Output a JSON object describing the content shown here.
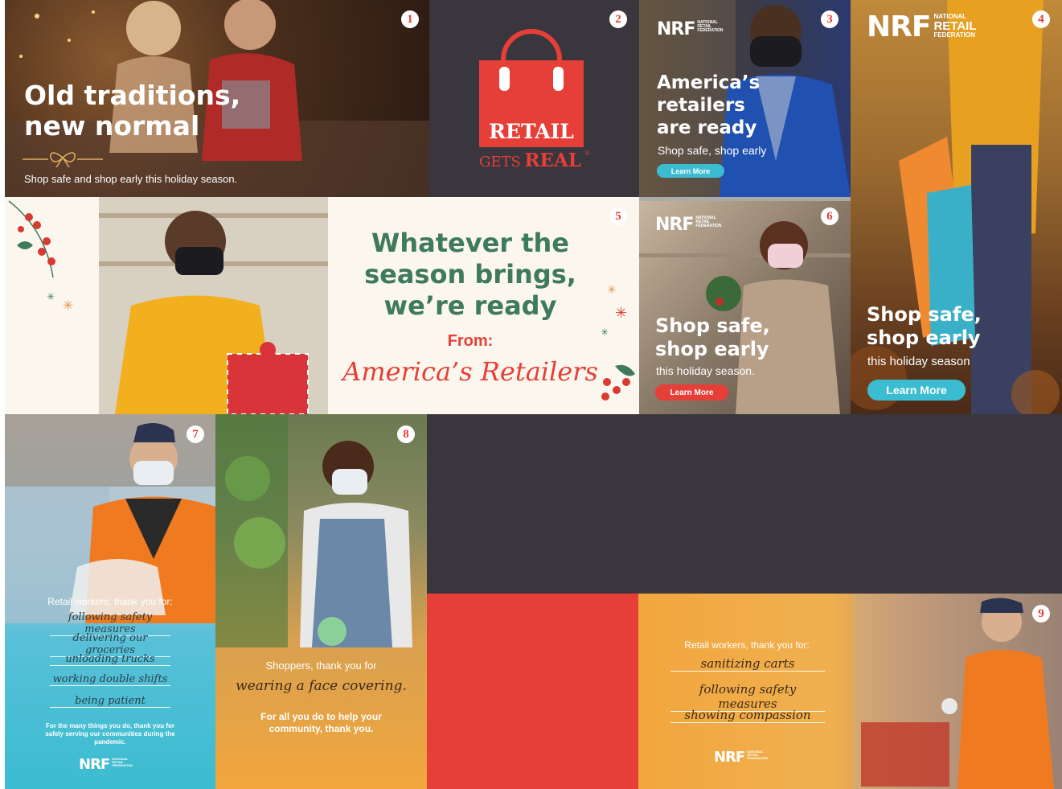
{
  "tiles": {
    "t1": {
      "num": "1",
      "headline_1": "Old traditions,",
      "headline_2": "new normal",
      "subtext": "Shop safe and shop early this holiday season."
    },
    "t2": {
      "num": "2",
      "logo_retail": "RETAIL",
      "logo_gets": "GETS",
      "logo_real": "REAL",
      "logo_reg": "®"
    },
    "t3": {
      "num": "3",
      "nrf": "NRF",
      "nrf_small": "NATIONAL RETAIL FEDERATION",
      "line1": "America’s",
      "line2": "retailers",
      "line3": "are ready",
      "sub": "Shop safe, shop early",
      "button": "Learn More"
    },
    "t4": {
      "num": "4",
      "nrf": "NRF",
      "nrf_small_1": "NATIONAL",
      "nrf_small_2": "RETAIL",
      "nrf_small_3": "FEDERATION",
      "line1": "Shop safe,",
      "line2": "shop early",
      "sub": "this holiday season",
      "button": "Learn More"
    },
    "t5": {
      "num": "5",
      "line1": "Whatever the",
      "line2": "season brings,",
      "line3": "we’re ready",
      "from": "From:",
      "signature": "America’s Retailers"
    },
    "t6": {
      "num": "6",
      "nrf": "NRF",
      "nrf_small": "NATIONAL RETAIL FEDERATION",
      "line1": "Shop safe,",
      "line2": "shop early",
      "sub": "this holiday season.",
      "button": "Learn More"
    },
    "t7": {
      "num": "7",
      "intro": "Retail workers, thank you for:",
      "items": [
        "following safety measures",
        "delivering our groceries",
        "unloading trucks",
        "working double shifts",
        "being patient"
      ],
      "footer": "For the many things you do, thank you for safely serving our communities during the pandemic.",
      "nrf": "NRF",
      "nrf_small": "NATIONAL RETAIL FEDERATION"
    },
    "t8": {
      "num": "8",
      "intro": "Shoppers, thank you for",
      "hand": "wearing a face covering.",
      "footer": "For all you do to help your community, thank you."
    },
    "t9": {
      "num": "9",
      "intro": "Retail workers, thank you for:",
      "items": [
        "sanitizing carts",
        "following safety measures",
        "showing compassion"
      ],
      "nrf": "NRF",
      "nrf_small": "NATIONAL RETAIL FEDERATION"
    }
  },
  "colors": {
    "brand_red": "#e53f37",
    "dark": "#3a363e",
    "green": "#3f7a5c",
    "teal": "#3bbcd0",
    "orange": "#f2a63d"
  }
}
